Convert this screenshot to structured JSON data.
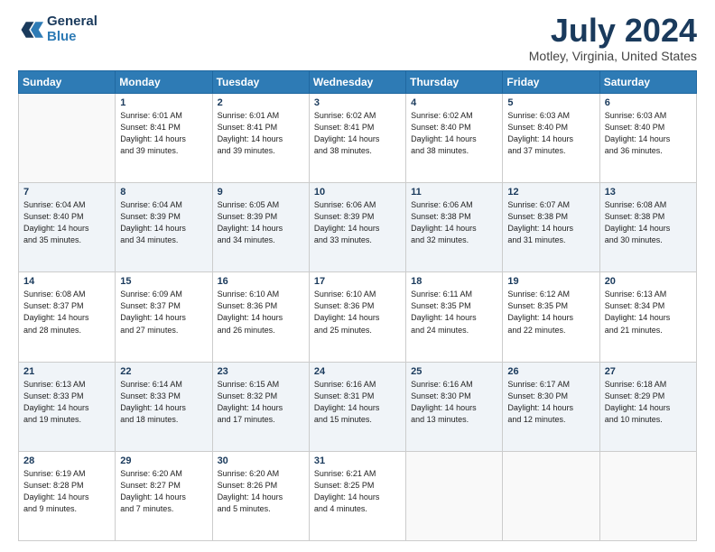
{
  "header": {
    "logo_line1": "General",
    "logo_line2": "Blue",
    "month_title": "July 2024",
    "location": "Motley, Virginia, United States"
  },
  "days_of_week": [
    "Sunday",
    "Monday",
    "Tuesday",
    "Wednesday",
    "Thursday",
    "Friday",
    "Saturday"
  ],
  "weeks": [
    [
      {
        "day": "",
        "info": ""
      },
      {
        "day": "1",
        "info": "Sunrise: 6:01 AM\nSunset: 8:41 PM\nDaylight: 14 hours\nand 39 minutes."
      },
      {
        "day": "2",
        "info": "Sunrise: 6:01 AM\nSunset: 8:41 PM\nDaylight: 14 hours\nand 39 minutes."
      },
      {
        "day": "3",
        "info": "Sunrise: 6:02 AM\nSunset: 8:41 PM\nDaylight: 14 hours\nand 38 minutes."
      },
      {
        "day": "4",
        "info": "Sunrise: 6:02 AM\nSunset: 8:40 PM\nDaylight: 14 hours\nand 38 minutes."
      },
      {
        "day": "5",
        "info": "Sunrise: 6:03 AM\nSunset: 8:40 PM\nDaylight: 14 hours\nand 37 minutes."
      },
      {
        "day": "6",
        "info": "Sunrise: 6:03 AM\nSunset: 8:40 PM\nDaylight: 14 hours\nand 36 minutes."
      }
    ],
    [
      {
        "day": "7",
        "info": "Sunrise: 6:04 AM\nSunset: 8:40 PM\nDaylight: 14 hours\nand 35 minutes."
      },
      {
        "day": "8",
        "info": "Sunrise: 6:04 AM\nSunset: 8:39 PM\nDaylight: 14 hours\nand 34 minutes."
      },
      {
        "day": "9",
        "info": "Sunrise: 6:05 AM\nSunset: 8:39 PM\nDaylight: 14 hours\nand 34 minutes."
      },
      {
        "day": "10",
        "info": "Sunrise: 6:06 AM\nSunset: 8:39 PM\nDaylight: 14 hours\nand 33 minutes."
      },
      {
        "day": "11",
        "info": "Sunrise: 6:06 AM\nSunset: 8:38 PM\nDaylight: 14 hours\nand 32 minutes."
      },
      {
        "day": "12",
        "info": "Sunrise: 6:07 AM\nSunset: 8:38 PM\nDaylight: 14 hours\nand 31 minutes."
      },
      {
        "day": "13",
        "info": "Sunrise: 6:08 AM\nSunset: 8:38 PM\nDaylight: 14 hours\nand 30 minutes."
      }
    ],
    [
      {
        "day": "14",
        "info": "Sunrise: 6:08 AM\nSunset: 8:37 PM\nDaylight: 14 hours\nand 28 minutes."
      },
      {
        "day": "15",
        "info": "Sunrise: 6:09 AM\nSunset: 8:37 PM\nDaylight: 14 hours\nand 27 minutes."
      },
      {
        "day": "16",
        "info": "Sunrise: 6:10 AM\nSunset: 8:36 PM\nDaylight: 14 hours\nand 26 minutes."
      },
      {
        "day": "17",
        "info": "Sunrise: 6:10 AM\nSunset: 8:36 PM\nDaylight: 14 hours\nand 25 minutes."
      },
      {
        "day": "18",
        "info": "Sunrise: 6:11 AM\nSunset: 8:35 PM\nDaylight: 14 hours\nand 24 minutes."
      },
      {
        "day": "19",
        "info": "Sunrise: 6:12 AM\nSunset: 8:35 PM\nDaylight: 14 hours\nand 22 minutes."
      },
      {
        "day": "20",
        "info": "Sunrise: 6:13 AM\nSunset: 8:34 PM\nDaylight: 14 hours\nand 21 minutes."
      }
    ],
    [
      {
        "day": "21",
        "info": "Sunrise: 6:13 AM\nSunset: 8:33 PM\nDaylight: 14 hours\nand 19 minutes."
      },
      {
        "day": "22",
        "info": "Sunrise: 6:14 AM\nSunset: 8:33 PM\nDaylight: 14 hours\nand 18 minutes."
      },
      {
        "day": "23",
        "info": "Sunrise: 6:15 AM\nSunset: 8:32 PM\nDaylight: 14 hours\nand 17 minutes."
      },
      {
        "day": "24",
        "info": "Sunrise: 6:16 AM\nSunset: 8:31 PM\nDaylight: 14 hours\nand 15 minutes."
      },
      {
        "day": "25",
        "info": "Sunrise: 6:16 AM\nSunset: 8:30 PM\nDaylight: 14 hours\nand 13 minutes."
      },
      {
        "day": "26",
        "info": "Sunrise: 6:17 AM\nSunset: 8:30 PM\nDaylight: 14 hours\nand 12 minutes."
      },
      {
        "day": "27",
        "info": "Sunrise: 6:18 AM\nSunset: 8:29 PM\nDaylight: 14 hours\nand 10 minutes."
      }
    ],
    [
      {
        "day": "28",
        "info": "Sunrise: 6:19 AM\nSunset: 8:28 PM\nDaylight: 14 hours\nand 9 minutes."
      },
      {
        "day": "29",
        "info": "Sunrise: 6:20 AM\nSunset: 8:27 PM\nDaylight: 14 hours\nand 7 minutes."
      },
      {
        "day": "30",
        "info": "Sunrise: 6:20 AM\nSunset: 8:26 PM\nDaylight: 14 hours\nand 5 minutes."
      },
      {
        "day": "31",
        "info": "Sunrise: 6:21 AM\nSunset: 8:25 PM\nDaylight: 14 hours\nand 4 minutes."
      },
      {
        "day": "",
        "info": ""
      },
      {
        "day": "",
        "info": ""
      },
      {
        "day": "",
        "info": ""
      }
    ]
  ]
}
